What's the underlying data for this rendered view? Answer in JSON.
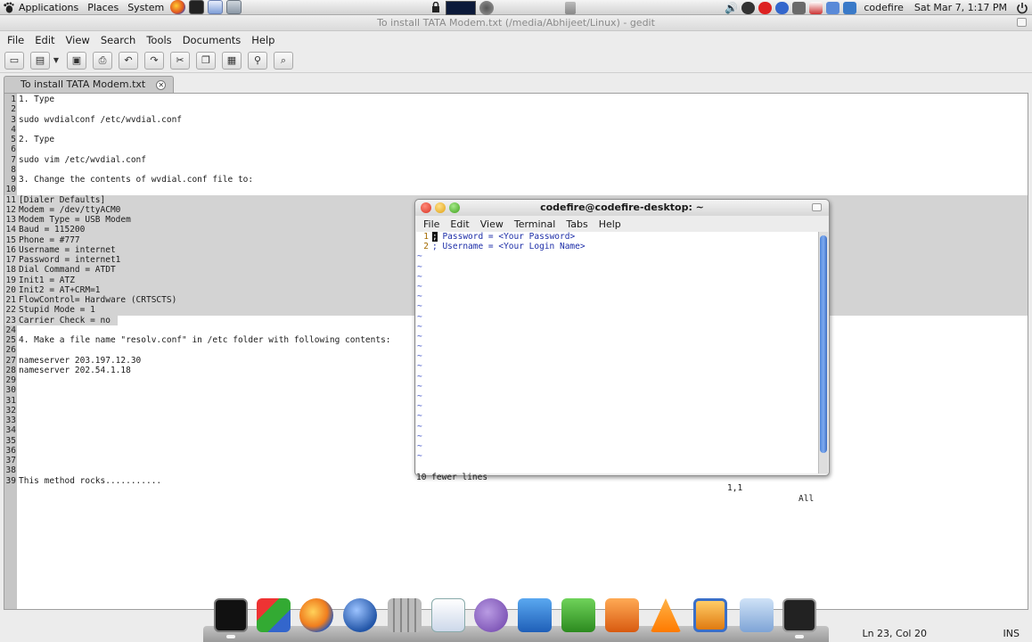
{
  "top_panel": {
    "menus": [
      "Applications",
      "Places",
      "System"
    ],
    "user": "codefire",
    "clock": "Sat Mar 7,  1:17 PM"
  },
  "gedit": {
    "title": "To install TATA Modem.txt (/media/Abhijeet/Linux) - gedit",
    "menu": [
      "File",
      "Edit",
      "View",
      "Search",
      "Tools",
      "Documents",
      "Help"
    ],
    "tab_label": "To install TATA Modem.txt",
    "lines": [
      {
        "n": "1",
        "t": "1. Type"
      },
      {
        "n": "2",
        "t": ""
      },
      {
        "n": "3",
        "t": "sudo wvdialconf /etc/wvdial.conf"
      },
      {
        "n": "4",
        "t": ""
      },
      {
        "n": "5",
        "t": "2. Type"
      },
      {
        "n": "6",
        "t": ""
      },
      {
        "n": "7",
        "t": "sudo vim /etc/wvdial.conf"
      },
      {
        "n": "8",
        "t": ""
      },
      {
        "n": "9",
        "t": "3. Change the contents of wvdial.conf file to:"
      },
      {
        "n": "10",
        "t": ""
      },
      {
        "n": "11",
        "t": "[Dialer Defaults]"
      },
      {
        "n": "12",
        "t": "Modem = /dev/ttyACM0"
      },
      {
        "n": "13",
        "t": "Modem Type = USB Modem"
      },
      {
        "n": "14",
        "t": "Baud = 115200"
      },
      {
        "n": "15",
        "t": "Phone = #777"
      },
      {
        "n": "16",
        "t": "Username = internet"
      },
      {
        "n": "17",
        "t": "Password = internet1"
      },
      {
        "n": "18",
        "t": "Dial Command = ATDT"
      },
      {
        "n": "19",
        "t": "Init1 = ATZ"
      },
      {
        "n": "20",
        "t": "Init2 = AT+CRM=1"
      },
      {
        "n": "21",
        "t": "FlowControl= Hardware (CRTSCTS)"
      },
      {
        "n": "22",
        "t": "Stupid Mode = 1"
      },
      {
        "n": "23",
        "t": "Carrier Check = no "
      },
      {
        "n": "24",
        "t": ""
      },
      {
        "n": "25",
        "t": "4. Make a file name \"resolv.conf\" in /etc folder with following contents:"
      },
      {
        "n": "26",
        "t": ""
      },
      {
        "n": "27",
        "t": "nameserver 203.197.12.30"
      },
      {
        "n": "28",
        "t": "nameserver 202.54.1.18"
      },
      {
        "n": "29",
        "t": ""
      },
      {
        "n": "30",
        "t": ""
      },
      {
        "n": "31",
        "t": ""
      },
      {
        "n": "32",
        "t": ""
      },
      {
        "n": "33",
        "t": ""
      },
      {
        "n": "34",
        "t": ""
      },
      {
        "n": "35",
        "t": ""
      },
      {
        "n": "36",
        "t": ""
      },
      {
        "n": "37",
        "t": ""
      },
      {
        "n": "38",
        "t": ""
      },
      {
        "n": "39",
        "t": "This method rocks..........."
      }
    ],
    "status_position": "Ln 23, Col 20",
    "status_mode": "INS"
  },
  "terminal": {
    "title": "codefire@codefire-desktop: ~",
    "menu": [
      "File",
      "Edit",
      "View",
      "Terminal",
      "Tabs",
      "Help"
    ],
    "lines": [
      {
        "n": "1",
        "t": "; Password = <Your Password>",
        "cursor": ";"
      },
      {
        "n": "2",
        "t": "; Username = <Your Login Name>"
      }
    ],
    "tilde_count": 21,
    "tilde": "~",
    "status_left": "10 fewer lines",
    "status_pos": "1,1",
    "status_scroll": "All"
  }
}
